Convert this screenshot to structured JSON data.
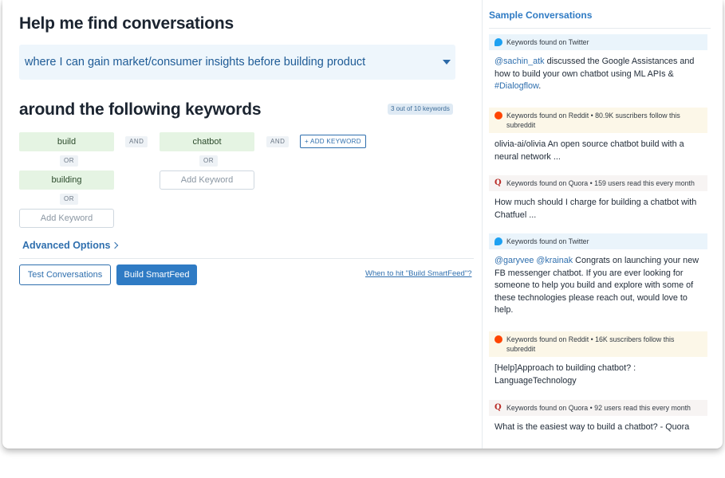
{
  "left": {
    "title": "Help me find conversations",
    "goal": "where I can gain market/consumer insights before building product",
    "subtitle": "around the following keywords",
    "keyword_count": "3 out of 10 keywords",
    "groups": [
      {
        "keywords": [
          "build",
          "building"
        ],
        "or_label": "OR",
        "add_placeholder": "Add Keyword"
      },
      {
        "keywords": [
          "chatbot"
        ],
        "or_label": "OR",
        "add_placeholder": "Add Keyword"
      }
    ],
    "and_label": "AND",
    "add_keyword_button": "+ ADD KEYWORD",
    "advanced_options": "Advanced Options",
    "test_button": "Test Conversations",
    "build_button": "Build SmartFeed",
    "when_link": "When to hit \"Build SmartFeed\"?"
  },
  "right": {
    "title": "Sample Conversations",
    "conversations": [
      {
        "source": "twitter",
        "icon": "twitter-icon",
        "header": "Keywords found on Twitter",
        "parts": [
          [
            "@sachin_atk",
            true
          ],
          [
            " discussed the Google Assistances and how to build your own chatbot using ML APIs & ",
            false
          ],
          [
            "#Dialogflow",
            true
          ],
          [
            ".",
            false
          ]
        ]
      },
      {
        "source": "reddit",
        "icon": "reddit-icon",
        "header": "Keywords found on Reddit • 80.9K suscribers follow this subreddit",
        "parts": [
          [
            "olivia-ai/olivia An open source chatbot build with a neural network ...",
            false
          ]
        ]
      },
      {
        "source": "quora",
        "icon": "quora-icon",
        "header": "Keywords found on Quora • 159 users read this every month",
        "parts": [
          [
            "How much should I charge for building a chatbot with Chatfuel ...",
            false
          ]
        ]
      },
      {
        "source": "twitter",
        "icon": "twitter-icon",
        "header": "Keywords found on Twitter",
        "parts": [
          [
            "@garyvee",
            true
          ],
          [
            " ",
            false
          ],
          [
            "@krainak",
            true
          ],
          [
            " Congrats on launching your new FB messenger chatbot. If you are ever looking for someone to help you build and explore with some of these technologies please reach out, would love to help.",
            false
          ]
        ]
      },
      {
        "source": "reddit",
        "icon": "reddit-icon",
        "header": "Keywords found on Reddit • 16K suscribers follow this subreddit",
        "parts": [
          [
            "[Help]Approach to building chatbot? : LanguageTechnology",
            false
          ]
        ]
      },
      {
        "source": "quora",
        "icon": "quora-icon",
        "header": "Keywords found on Quora • 92 users read this every month",
        "parts": [
          [
            "What is the easiest way to build a chatbot? - Quora",
            false
          ]
        ]
      }
    ]
  }
}
